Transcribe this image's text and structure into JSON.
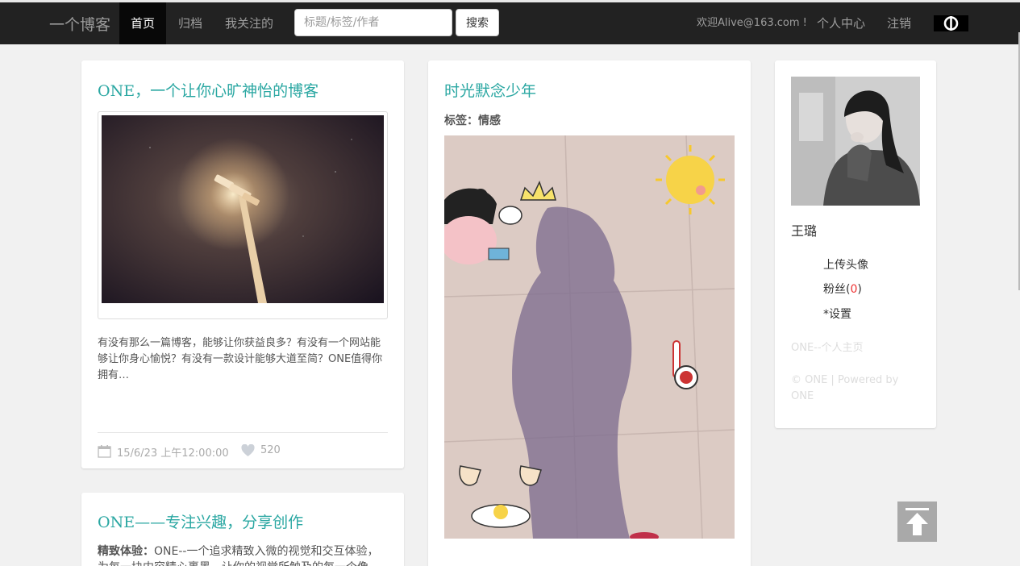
{
  "nav": {
    "logo": "一个博客",
    "items": [
      {
        "label": "首页",
        "active": true
      },
      {
        "label": "归档",
        "active": false
      },
      {
        "label": "我关注的",
        "active": false
      }
    ],
    "search_placeholder": "标题/标签/作者",
    "search_button": "搜索",
    "welcome": "欢迎Alive@163.com !",
    "profile_link": "个人中心",
    "logout_link": "注销"
  },
  "posts": [
    {
      "title": "ONE，一个让你心旷神怡的博客",
      "excerpt": "有没有那么一篇博客，能够让你获益良多？有没有一个网站能够让你身心愉悦？有没有一款设计能够大道至简？ONE值得你拥有…",
      "date": "15/6/23 上午12:00:00",
      "likes": "520"
    },
    {
      "title": "时光默念少年",
      "tag_label": "标签：",
      "tag_value": "情感"
    },
    {
      "title": "ONE——专注兴趣，分享创作",
      "excerpt_label": "精致体验：",
      "excerpt": "ONE--一个追求精致入微的视觉和交互体验，为每一块内容精心裹黑，让你的视觉所触及的每一个像"
    }
  ],
  "profile": {
    "name": "王璐",
    "upload_avatar": "上传头像",
    "fans_label": "粉丝(",
    "fans_count": "0",
    "fans_close": ")",
    "settings": "*设置",
    "home_link": "ONE--个人主页",
    "footer": "© ONE | Powered by ONE"
  },
  "colors": {
    "accent": "#2aa7a2",
    "nav_bg": "#222222",
    "fans_count": "#e33333"
  }
}
